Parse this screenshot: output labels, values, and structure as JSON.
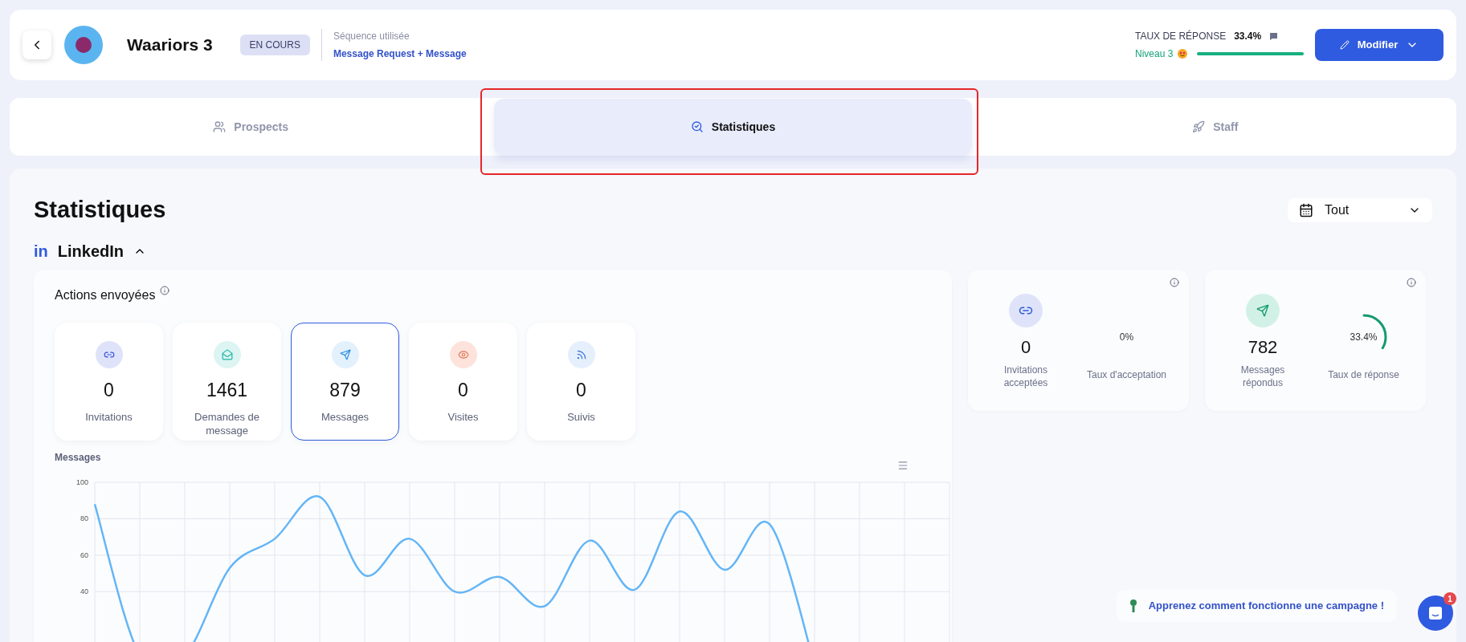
{
  "header": {
    "title": "Waariors 3",
    "status": "EN COURS",
    "sequence_label": "Séquence utilisée",
    "sequence_name": "Message Request + Message",
    "response_label": "TAUX DE RÉPONSE",
    "response_value": "33.4%",
    "level_label": "Niveau 3",
    "level": 1,
    "button": "Modifier"
  },
  "tabs": [
    {
      "label": "Prospects",
      "selected": false
    },
    {
      "label": "Statistiques",
      "selected": true
    },
    {
      "label": "Staff",
      "selected": false
    }
  ],
  "stats": {
    "title": "Statistiques",
    "period": "Tout",
    "section_logo": "in",
    "section": "LinkedIn",
    "expanded": true,
    "actions_title": "Actions envoyées",
    "actions": [
      {
        "value": "0",
        "label": "Invitations",
        "selected": false,
        "color": "#dfe3fa"
      },
      {
        "value": "1461",
        "label": "Demandes de message",
        "selected": false,
        "color": "#dcf5f2"
      },
      {
        "value": "879",
        "label": "Messages",
        "selected": true,
        "color": "#e3f1fd"
      },
      {
        "value": "0",
        "label": "Visites",
        "selected": false,
        "color": "#fde3dc"
      },
      {
        "value": "0",
        "label": "Suivis",
        "selected": false,
        "color": "#e6effc"
      }
    ],
    "summaries": [
      {
        "count": "0",
        "count_label": "Invitations acceptées",
        "rate": "0%",
        "rate_label": "Taux d'acceptation",
        "color": "#dfe3fa"
      },
      {
        "count": "782",
        "count_label": "Messages répondus",
        "rate": "33.4%",
        "rate_label": "Taux de réponse",
        "level": 0.334,
        "color": "#d2f1e6"
      }
    ],
    "chart_data": {
      "type": "line",
      "title": "Messages",
      "grid": true,
      "series": [
        {
          "color": "#64b5f6",
          "values": [
            88,
            5,
            5,
            53,
            69,
            92,
            49,
            69,
            40,
            48,
            32,
            68,
            41,
            84,
            52,
            77,
            0,
            null,
            null,
            null
          ]
        }
      ],
      "ylim": [
        0,
        100
      ],
      "yticks": [
        40,
        60,
        80,
        100
      ]
    },
    "help_link": "Apprenez comment fonctionne une campagne !"
  },
  "chat": {
    "badge": "1"
  }
}
